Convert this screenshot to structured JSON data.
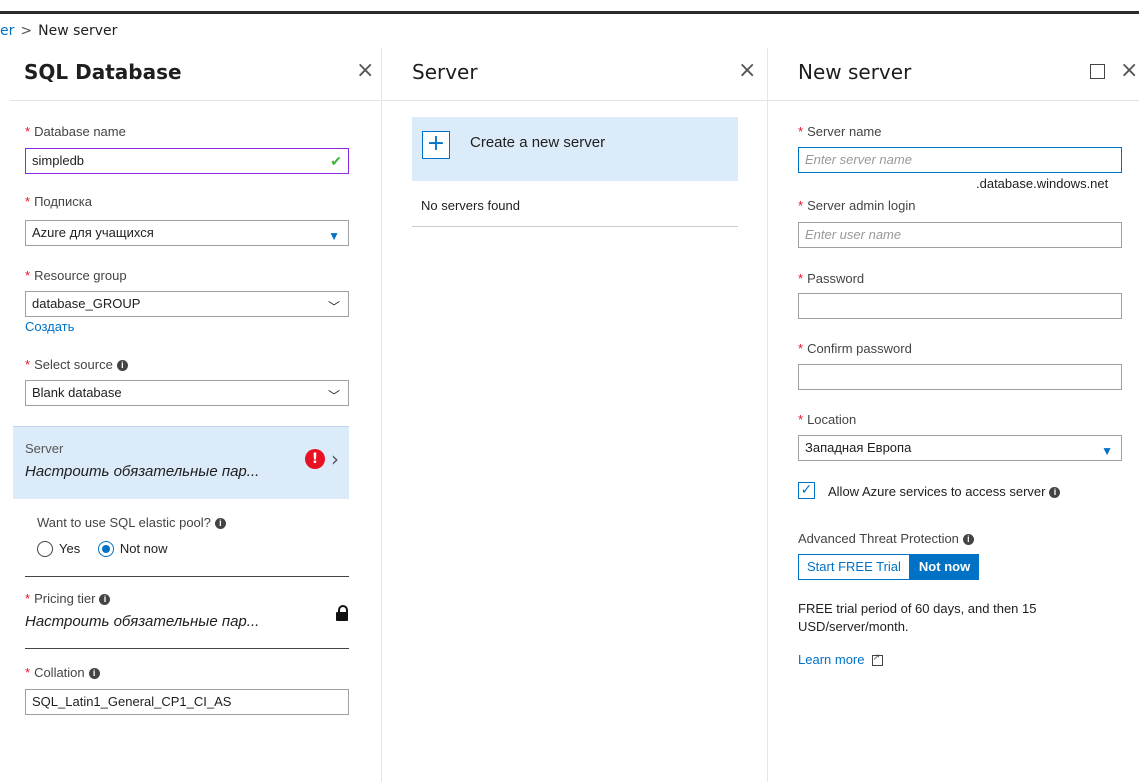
{
  "breadcrumb": {
    "parent": "er",
    "separator": ">",
    "current": "New server"
  },
  "sql_blade": {
    "title": "SQL Database",
    "close_icon": "×",
    "db_name_label": "Database name",
    "db_name_value": "simpledb",
    "subscription_label": "Подписка",
    "subscription_value": "Azure для учащихся",
    "rg_label": "Resource group",
    "rg_value": "database_GROUP",
    "rg_create_link": "Создать",
    "source_label": "Select source",
    "source_value": "Blank database",
    "server_label": "Server",
    "server_value": "Настроить обязательные пар...",
    "pool_label": "Want to use SQL elastic pool?",
    "pool_yes": "Yes",
    "pool_no": "Not now",
    "pool_selected": "Not now",
    "pricing_label": "Pricing tier",
    "pricing_value": "Настроить обязательные пар...",
    "collation_label": "Collation",
    "collation_value": "SQL_Latin1_General_CP1_CI_AS"
  },
  "server_blade": {
    "title": "Server",
    "close_icon": "×",
    "create_label": "Create a new server",
    "empty_text": "No servers found"
  },
  "new_server_blade": {
    "title": "New server",
    "close_icon": "×",
    "name_label": "Server name",
    "name_placeholder": "Enter server name",
    "domain_suffix": ".database.windows.net",
    "admin_label": "Server admin login",
    "admin_placeholder": "Enter user name",
    "password_label": "Password",
    "confirm_label": "Confirm password",
    "location_label": "Location",
    "location_value": "Западная Европа",
    "allow_azure_label": "Allow Azure services to access server",
    "allow_azure_checked": true,
    "atp_label": "Advanced Threat Protection",
    "atp_trial": "Start FREE Trial",
    "atp_notnow": "Not now",
    "atp_selected": "Not now",
    "note": "FREE trial period of 60 days, and then 15 USD/server/month.",
    "learn_more": "Learn more"
  },
  "colors": {
    "accent": "#0072c6",
    "required": "#e81123",
    "selected_bg": "#dcebf9",
    "error": "#e81123"
  }
}
